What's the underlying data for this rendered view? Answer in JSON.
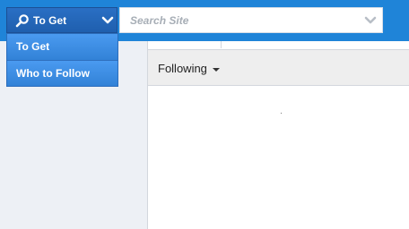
{
  "search": {
    "type_selected": "To Get",
    "placeholder": "Search Site",
    "value": ""
  },
  "search_type_menu": {
    "items": [
      {
        "label": "To Get"
      },
      {
        "label": "Who to Follow"
      }
    ]
  },
  "feed": {
    "filter_label": "Following"
  },
  "colors": {
    "topbar": "#1f84d8",
    "menu": "#3d8fe0",
    "sidebar": "#edf0f5"
  },
  "icons": [
    "search-icon",
    "chevron-down-icon",
    "caret-down-icon"
  ]
}
